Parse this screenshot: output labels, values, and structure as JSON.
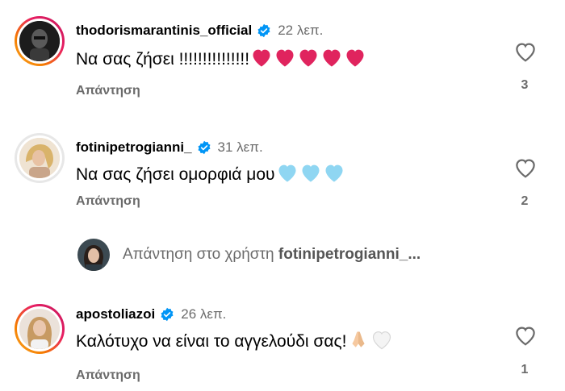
{
  "comments": [
    {
      "username": "thodorismarantinis_official",
      "time": "22 λεπ.",
      "text": "Να σας ζήσει !!!!!!!!!!!!!!!",
      "emojis": [
        "heart-red",
        "heart-red",
        "heart-red",
        "heart-red",
        "heart-red"
      ],
      "reply_label": "Απάντηση",
      "like_count": "3"
    },
    {
      "username": "fotinipetrogianni_",
      "time": "31 λεπ.",
      "text": "Να σας ζήσει ομορφιά μου",
      "emojis": [
        "heart-light-blue",
        "heart-light-blue",
        "heart-light-blue"
      ],
      "reply_label": "Απάντηση",
      "like_count": "2"
    },
    {
      "username": "apostoliazoi",
      "time": "26 λεπ.",
      "text": "Καλότυχο να είναι το αγγελούδι σας!",
      "emojis": [
        "folded-hands",
        "heart-white"
      ],
      "reply_label": "Απάντηση",
      "like_count": "1"
    }
  ],
  "reply_prompt": {
    "prefix": "Απάντηση στο χρήστη",
    "target": "fotinipetrogianni_..."
  },
  "colors": {
    "verified": "#0095f6",
    "heart_red": "#e0245e",
    "heart_light_blue": "#8fd6f2",
    "secondary_text": "#6b6b6b"
  }
}
